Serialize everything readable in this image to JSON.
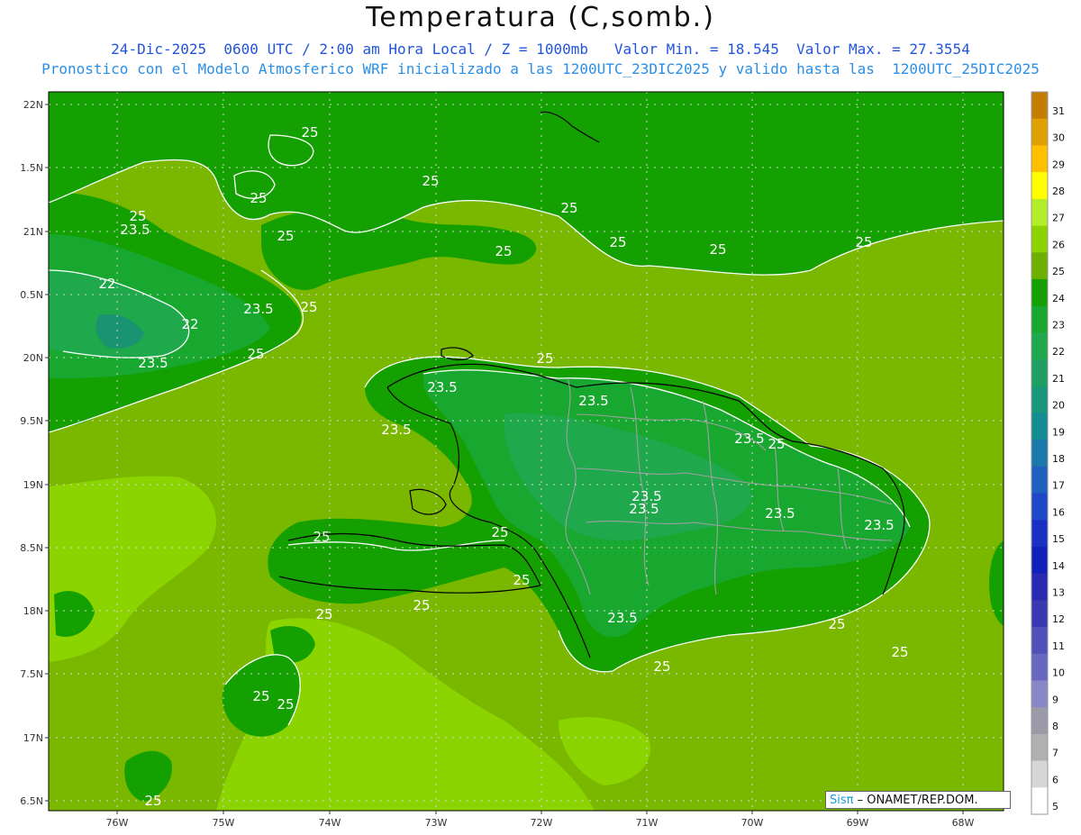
{
  "header": {
    "title": "Temperatura (C,somb.)",
    "subtitle1": "24-Dic-2025  0600 UTC / 2:00 am Hora Local / Z = 1000mb   Valor Min. = 18.545  Valor Max. = 27.3554",
    "subtitle2": "Pronostico con el Modelo Atmosferico WRF inicializado a las 1200UTC_23DIC2025 y valido hasta las  1200UTC_25DIC2025"
  },
  "map": {
    "lat_labels": [
      "22N",
      "1.5N",
      "21N",
      "0.5N",
      "20N",
      "9.5N",
      "19N",
      "8.5N",
      "18N",
      "7.5N",
      "17N",
      "6.5N"
    ],
    "lon_labels": [
      "76W",
      "75W",
      "74W",
      "73W",
      "72W",
      "71W",
      "70W",
      "69W",
      "68W"
    ],
    "contour_labels": [
      {
        "text": "25"
      },
      {
        "text": "25"
      },
      {
        "text": "25"
      },
      {
        "text": "25"
      },
      {
        "text": "23.5"
      },
      {
        "text": "25"
      },
      {
        "text": "25"
      },
      {
        "text": "25"
      },
      {
        "text": "25"
      },
      {
        "text": "25"
      },
      {
        "text": "22"
      },
      {
        "text": "23.5"
      },
      {
        "text": "25"
      },
      {
        "text": "22"
      },
      {
        "text": "23.5"
      },
      {
        "text": "25"
      },
      {
        "text": "25"
      },
      {
        "text": "23.5"
      },
      {
        "text": "23.5"
      },
      {
        "text": "25"
      },
      {
        "text": "23.5"
      },
      {
        "text": "25"
      },
      {
        "text": "23.5"
      },
      {
        "text": "23.5"
      },
      {
        "text": "23.5"
      },
      {
        "text": "23.5"
      },
      {
        "text": "23.5"
      },
      {
        "text": "25"
      },
      {
        "text": "25"
      },
      {
        "text": "25"
      },
      {
        "text": "25"
      },
      {
        "text": "23.5"
      },
      {
        "text": "25"
      },
      {
        "text": "25"
      },
      {
        "text": "25"
      },
      {
        "text": "25"
      },
      {
        "text": "25"
      },
      {
        "text": "25"
      }
    ]
  },
  "colorbar": {
    "levels": [
      "31",
      "30",
      "29",
      "28",
      "27",
      "26",
      "25",
      "24",
      "23",
      "22",
      "21",
      "20",
      "19",
      "18",
      "17",
      "16",
      "15",
      "14",
      "13",
      "12",
      "11",
      "10",
      "9",
      "8",
      "7",
      "6",
      "5"
    ],
    "colors": [
      "#c47d00",
      "#e0a000",
      "#ffc000",
      "#ffff00",
      "#b4ee2a",
      "#8cd400",
      "#6eb000",
      "#14a000",
      "#18a830",
      "#1fa84c",
      "#1fa062",
      "#18987a",
      "#148c92",
      "#1a78aa",
      "#1e60c0",
      "#1e48c8",
      "#1830c4",
      "#1020b8",
      "#2828b0",
      "#3838b0",
      "#5050b8",
      "#6868c0",
      "#8888c8",
      "#9a9aa8",
      "#b0b0b0",
      "#d6d6d6",
      "#ffffff"
    ]
  },
  "colors": {
    "sea_land_low": "#7ab800",
    "land_warm": "#8cd400",
    "band_24": "#14a000",
    "band_23": "#18a830",
    "band_22": "#1fa84c",
    "band_21": "#1a9470",
    "coast": "#000000",
    "province_border": "#a0a0a0",
    "contour": "#ffffff"
  },
  "credit": {
    "brand": "Sisπ",
    "org": " – ONAMET/REP.DOM."
  }
}
